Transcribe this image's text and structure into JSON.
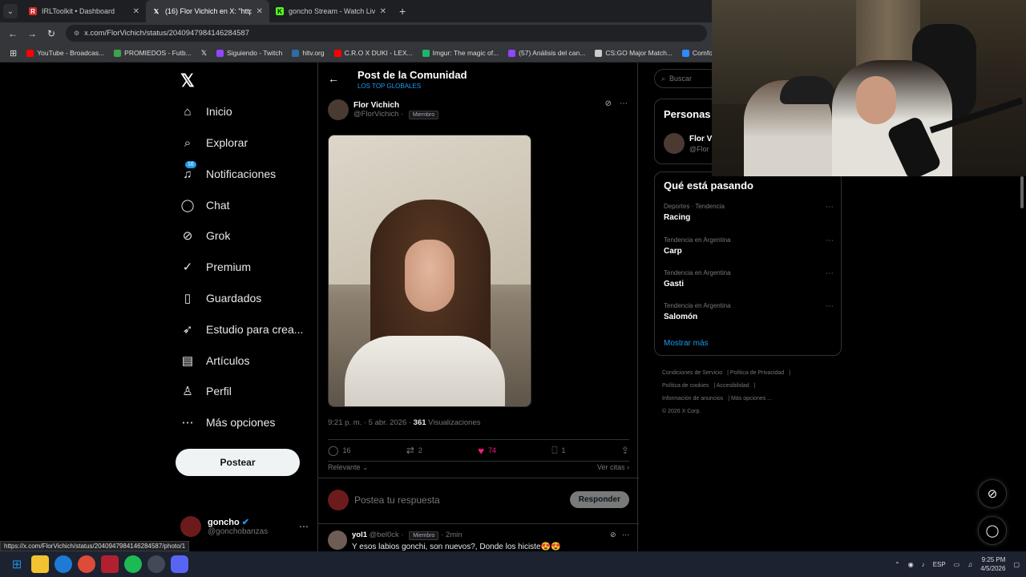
{
  "browser": {
    "tabs": [
      {
        "title": "IRLToolkit • Dashboard",
        "fav_color": "#d6282b",
        "fav_glyph": "R"
      },
      {
        "title": "(16) Flor Vichich en X: \"https://t",
        "fav_color": "#000000",
        "fav_glyph": "X"
      },
      {
        "title": "goncho Stream - Watch Live on",
        "fav_color": "#53fc18",
        "fav_glyph": "K"
      }
    ],
    "new_tab": "+",
    "url": "x.com/FlorVichich/status/2040947984146284587",
    "bookmarks": [
      {
        "label": "YouTube - Broadcas...",
        "color": "#ff0000"
      },
      {
        "label": "PROMIEDOS - Futb...",
        "color": "#3fa34d"
      },
      {
        "label": "",
        "color": "#ffffff"
      },
      {
        "label": "Siguiendo - Twitch",
        "color": "#9146ff"
      },
      {
        "label": "hltv.org",
        "color": "#2d6da3"
      },
      {
        "label": "C.R.O X DUKI - LEX...",
        "color": "#ff0000"
      },
      {
        "label": "Imgur: The magic of...",
        "color": "#1bb76e"
      },
      {
        "label": "(57) Análisis del can...",
        "color": "#9146ff"
      },
      {
        "label": "CS:GO Major Match...",
        "color": "#cccccc"
      },
      {
        "label": "Comfortably Nu",
        "color": "#2d8cff"
      }
    ]
  },
  "nav": {
    "items": [
      {
        "label": "Inicio",
        "icon": "⌂"
      },
      {
        "label": "Explorar",
        "icon": "⌕"
      },
      {
        "label": "Notificaciones",
        "icon": "🔔︎",
        "badge": "16"
      },
      {
        "label": "Chat",
        "icon": "◯"
      },
      {
        "label": "Grok",
        "icon": "⊘"
      },
      {
        "label": "Premium",
        "icon": "✓"
      },
      {
        "label": "Guardados",
        "icon": "▯"
      },
      {
        "label": "Estudio para crea...",
        "icon": "➶"
      },
      {
        "label": "Artículos",
        "icon": "▤"
      },
      {
        "label": "Perfil",
        "icon": "♙"
      },
      {
        "label": "Más opciones",
        "icon": "⋯"
      }
    ],
    "post_button": "Postear",
    "account": {
      "name": "goncho",
      "handle": "@gonchobanzas"
    }
  },
  "post": {
    "header_title": "Post de la Comunidad",
    "header_sub": "LOS TOP GLOBALES",
    "author_name": "Flor Vichich",
    "author_handle": "@FlorVichich",
    "member_badge": "Miembro",
    "time": "9:21 p. m. · 5 abr. 2026 · ",
    "views": "361",
    "views_label": " Visualizaciones",
    "replies": "16",
    "reposts": "2",
    "likes": "74",
    "bookmarks": "1",
    "sort_label": "Relevante",
    "quotes_label": "Ver citas",
    "reply_placeholder": "Postea tu respuesta",
    "reply_button": "Responder"
  },
  "reply": {
    "name": "yol1",
    "handle": "@bel0ck",
    "badge": "Miembro",
    "time": "2min",
    "text": "Y esos labios gonchi, son nuevos?, Donde los hiciste😍😍"
  },
  "sidebar": {
    "search_placeholder": "Buscar",
    "people_title": "Personas",
    "person_name": "Flor Vi",
    "person_handle": "@Flor",
    "trends_title": "Qué está pasando",
    "trends": [
      {
        "context": "Deportes · Tendencia",
        "name": "Racing"
      },
      {
        "context": "Tendencia en Argentina",
        "name": "Carp"
      },
      {
        "context": "Tendencia en Argentina",
        "name": "Gasti"
      },
      {
        "context": "Tendencia en Argentina",
        "name": "Salomón"
      }
    ],
    "show_more": "Mostrar más",
    "footer": [
      "Condiciones de Servicio",
      "Política de Privacidad",
      "Política de cookies",
      "Accesibilidad",
      "Información de anuncios",
      "Más opciones ...",
      "© 2026 X Corp."
    ]
  },
  "status_url": "https://x.com/FlorVichich/status/2040947984146284587/photo/1",
  "taskbar": {
    "apps": [
      {
        "name": "windows-start",
        "color": "#1d8fe0"
      },
      {
        "name": "file-explorer",
        "color": "#f2c230"
      },
      {
        "name": "edge",
        "color": "#1f7ad6"
      },
      {
        "name": "chrome",
        "color": "#dd4b39"
      },
      {
        "name": "irltoolkit",
        "color": "#b02030"
      },
      {
        "name": "spotify",
        "color": "#1db954"
      },
      {
        "name": "steam-helper",
        "color": "#444a55"
      },
      {
        "name": "discord",
        "color": "#5865f2"
      }
    ],
    "language": "ESP",
    "time": "9:25 PM",
    "date": "4/5/2026"
  }
}
